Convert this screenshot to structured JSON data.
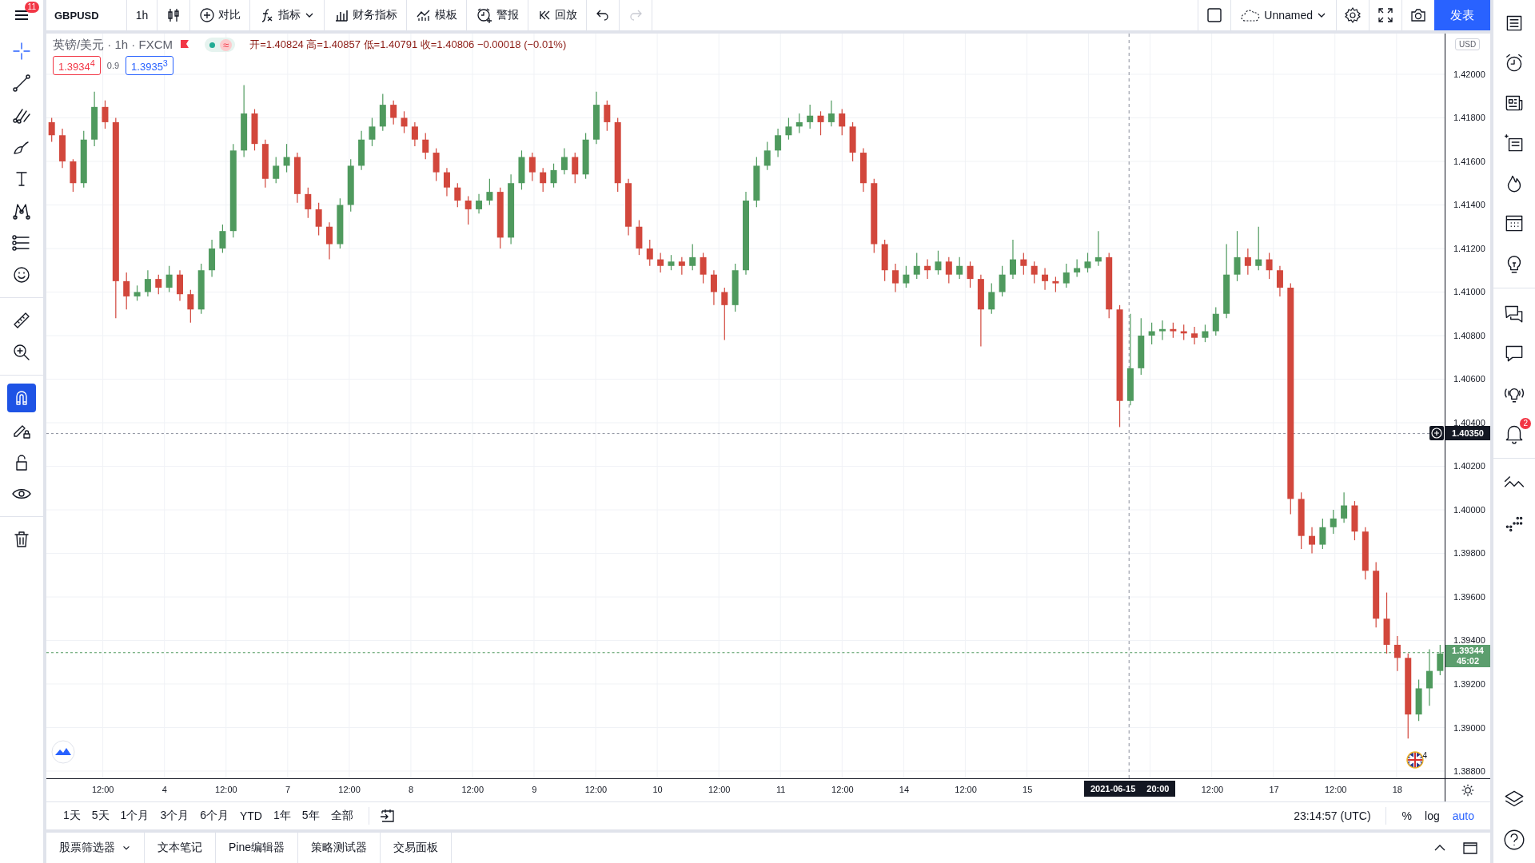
{
  "top_bar": {
    "menu_badge": "11",
    "symbol": "GBPUSD",
    "interval": "1h",
    "compare": "对比",
    "indicators": "指标",
    "financials": "财务指标",
    "templates": "模板",
    "alert": "警报",
    "replay": "回放",
    "redo_disabled": true,
    "layout_name": "Unnamed",
    "publish": "发表"
  },
  "tools": [
    {
      "kind": "crosshair",
      "active": true
    },
    {
      "kind": "trend-line",
      "active": false
    },
    {
      "kind": "pitchfork",
      "active": false
    },
    {
      "kind": "brush",
      "active": false
    },
    {
      "kind": "text",
      "active": false
    },
    {
      "kind": "pattern",
      "active": false
    },
    {
      "kind": "forecast",
      "active": false
    },
    {
      "kind": "emoji",
      "active": false
    },
    {
      "kind": "ruler",
      "active": false
    },
    {
      "kind": "zoom",
      "active": false
    },
    {
      "kind": "magnet",
      "active": true
    },
    {
      "kind": "lock-drawing",
      "active": false
    },
    {
      "kind": "lock",
      "active": false
    },
    {
      "kind": "eye",
      "active": false
    },
    {
      "kind": "trash",
      "active": false
    }
  ],
  "legend": {
    "title": "英镑/美元 · 1h · FXCM",
    "toggle_glyph": "≈",
    "ohlc": "开=1.40824 高=1.40857 低=1.40791 收=1.40806 −0.00018 (−0.01%)",
    "sell": "1.3934$^{4}$",
    "spread": "0.9",
    "buy": "1.3935$^{3}$"
  },
  "chart": {
    "chart_data": {
      "type": "candlestick",
      "categories": [
        null,
        null,
        null,
        null,
        null,
        null,
        null,
        null,
        null,
        null,
        null,
        null,
        null,
        null,
        null,
        null,
        null,
        null,
        null,
        null,
        null,
        null,
        null,
        null,
        null,
        null,
        null,
        null,
        null,
        null,
        null,
        null,
        null,
        null,
        null,
        null,
        null,
        null,
        null,
        null,
        null,
        null,
        null,
        null,
        null,
        null,
        null,
        null,
        null,
        null,
        null,
        null,
        null,
        null,
        null,
        null,
        null,
        null,
        null,
        null,
        null,
        null,
        null,
        null,
        null,
        null,
        null,
        null,
        null,
        null,
        null,
        null,
        null,
        null,
        null,
        null,
        null,
        null,
        null,
        null,
        null,
        null,
        null,
        null,
        null,
        null,
        null,
        null,
        null,
        null,
        null,
        null,
        null,
        null,
        null,
        null,
        null,
        null,
        null,
        null,
        null,
        null,
        null,
        null,
        null,
        null,
        null,
        null,
        null,
        null,
        null,
        null,
        null,
        null,
        null,
        null,
        null,
        null,
        null,
        null,
        null,
        null,
        null,
        null,
        null,
        null,
        null,
        null,
        null,
        null,
        null
      ],
      "ohlc": [
        [
          1.4178,
          1.418,
          1.4169,
          1.4172
        ],
        [
          1.4172,
          1.4175,
          1.4157,
          1.416
        ],
        [
          1.416,
          1.4161,
          1.4146,
          1.415
        ],
        [
          1.415,
          1.4174,
          1.4148,
          1.417
        ],
        [
          1.417,
          1.4192,
          1.4167,
          1.4185
        ],
        [
          1.4185,
          1.4188,
          1.4175,
          1.4178
        ],
        [
          1.4178,
          1.418,
          1.4088,
          1.4105
        ],
        [
          1.4105,
          1.4109,
          1.4092,
          1.4098
        ],
        [
          1.4098,
          1.4103,
          1.4096,
          1.41
        ],
        [
          1.41,
          1.411,
          1.4098,
          1.4106
        ],
        [
          1.4106,
          1.4108,
          1.4099,
          1.4102
        ],
        [
          1.4102,
          1.4112,
          1.41,
          1.4108
        ],
        [
          1.4108,
          1.411,
          1.4096,
          1.4099
        ],
        [
          1.4099,
          1.4101,
          1.4086,
          1.4092
        ],
        [
          1.4092,
          1.4113,
          1.409,
          1.411
        ],
        [
          1.411,
          1.4124,
          1.4107,
          1.412
        ],
        [
          1.412,
          1.4131,
          1.4118,
          1.4128
        ],
        [
          1.4128,
          1.4168,
          1.4125,
          1.4165
        ],
        [
          1.4165,
          1.4195,
          1.4162,
          1.4182
        ],
        [
          1.4182,
          1.4184,
          1.4165,
          1.4168
        ],
        [
          1.4168,
          1.417,
          1.4148,
          1.4152
        ],
        [
          1.4152,
          1.4162,
          1.415,
          1.4158
        ],
        [
          1.4158,
          1.4168,
          1.4155,
          1.4162
        ],
        [
          1.4162,
          1.4164,
          1.4141,
          1.4145
        ],
        [
          1.4145,
          1.4148,
          1.4134,
          1.4138
        ],
        [
          1.4138,
          1.4141,
          1.4126,
          1.413
        ],
        [
          1.413,
          1.4132,
          1.4115,
          1.4122
        ],
        [
          1.4122,
          1.4143,
          1.412,
          1.414
        ],
        [
          1.414,
          1.4161,
          1.4137,
          1.4158
        ],
        [
          1.4158,
          1.4174,
          1.4156,
          1.417
        ],
        [
          1.417,
          1.418,
          1.4167,
          1.4176
        ],
        [
          1.4176,
          1.4191,
          1.4174,
          1.4186
        ],
        [
          1.4186,
          1.4188,
          1.4177,
          1.418
        ],
        [
          1.418,
          1.4183,
          1.4173,
          1.4176
        ],
        [
          1.4176,
          1.4178,
          1.4167,
          1.417
        ],
        [
          1.417,
          1.4173,
          1.4161,
          1.4164
        ],
        [
          1.4164,
          1.4166,
          1.4151,
          1.4155
        ],
        [
          1.4155,
          1.4157,
          1.4144,
          1.4148
        ],
        [
          1.4148,
          1.415,
          1.4139,
          1.4142
        ],
        [
          1.4142,
          1.4144,
          1.4131,
          1.4138
        ],
        [
          1.4138,
          1.4145,
          1.4136,
          1.4142
        ],
        [
          1.4142,
          1.4152,
          1.414,
          1.4146
        ],
        [
          1.4146,
          1.4148,
          1.412,
          1.4125
        ],
        [
          1.4125,
          1.4154,
          1.4122,
          1.415
        ],
        [
          1.415,
          1.4165,
          1.4147,
          1.4162
        ],
        [
          1.4162,
          1.4164,
          1.4151,
          1.4155
        ],
        [
          1.4155,
          1.4157,
          1.4146,
          1.415
        ],
        [
          1.415,
          1.4159,
          1.4148,
          1.4156
        ],
        [
          1.4156,
          1.4166,
          1.4154,
          1.4162
        ],
        [
          1.4162,
          1.4164,
          1.415,
          1.4154
        ],
        [
          1.4154,
          1.4173,
          1.4152,
          1.417
        ],
        [
          1.417,
          1.4192,
          1.4168,
          1.4186
        ],
        [
          1.4186,
          1.4188,
          1.4174,
          1.4178
        ],
        [
          1.4178,
          1.418,
          1.4146,
          1.415
        ],
        [
          1.415,
          1.4152,
          1.4126,
          1.413
        ],
        [
          1.413,
          1.4133,
          1.4117,
          1.412
        ],
        [
          1.412,
          1.4124,
          1.4112,
          1.4115
        ],
        [
          1.4115,
          1.4118,
          1.4109,
          1.4112
        ],
        [
          1.4112,
          1.4117,
          1.411,
          1.4114
        ],
        [
          1.4114,
          1.4116,
          1.4108,
          1.4112
        ],
        [
          1.4112,
          1.4122,
          1.411,
          1.4116
        ],
        [
          1.4116,
          1.4118,
          1.4104,
          1.4108
        ],
        [
          1.4108,
          1.411,
          1.4094,
          1.41
        ],
        [
          1.41,
          1.4102,
          1.4078,
          1.4094
        ],
        [
          1.4094,
          1.4113,
          1.4091,
          1.411
        ],
        [
          1.411,
          1.4146,
          1.4108,
          1.4142
        ],
        [
          1.4142,
          1.4162,
          1.4139,
          1.4158
        ],
        [
          1.4158,
          1.4169,
          1.4156,
          1.4165
        ],
        [
          1.4165,
          1.4175,
          1.4162,
          1.4172
        ],
        [
          1.4172,
          1.418,
          1.417,
          1.4176
        ],
        [
          1.4176,
          1.4182,
          1.4173,
          1.4178
        ],
        [
          1.4178,
          1.4186,
          1.4175,
          1.4181
        ],
        [
          1.4181,
          1.4183,
          1.4172,
          1.4178
        ],
        [
          1.4178,
          1.4188,
          1.4176,
          1.4182
        ],
        [
          1.4182,
          1.4184,
          1.4172,
          1.4176
        ],
        [
          1.4176,
          1.4178,
          1.416,
          1.4164
        ],
        [
          1.4164,
          1.4166,
          1.4146,
          1.415
        ],
        [
          1.415,
          1.4152,
          1.4118,
          1.4122
        ],
        [
          1.4122,
          1.4124,
          1.4105,
          1.411
        ],
        [
          1.411,
          1.4113,
          1.41,
          1.4104
        ],
        [
          1.4104,
          1.4112,
          1.4102,
          1.4108
        ],
        [
          1.4108,
          1.4118,
          1.4106,
          1.4112
        ],
        [
          1.4112,
          1.4115,
          1.4106,
          1.411
        ],
        [
          1.411,
          1.4119,
          1.4108,
          1.4114
        ],
        [
          1.4114,
          1.4116,
          1.4104,
          1.4108
        ],
        [
          1.4108,
          1.4116,
          1.4106,
          1.4112
        ],
        [
          1.4112,
          1.4114,
          1.4102,
          1.4106
        ],
        [
          1.4106,
          1.4108,
          1.4075,
          1.4092
        ],
        [
          1.4092,
          1.4104,
          1.409,
          1.41
        ],
        [
          1.41,
          1.4112,
          1.4098,
          1.4108
        ],
        [
          1.4108,
          1.4124,
          1.4106,
          1.4115
        ],
        [
          1.4115,
          1.4118,
          1.4108,
          1.4112
        ],
        [
          1.4112,
          1.4114,
          1.4104,
          1.4108
        ],
        [
          1.4108,
          1.4111,
          1.4101,
          1.4105
        ],
        [
          1.4105,
          1.4107,
          1.41,
          1.4104
        ],
        [
          1.4104,
          1.4113,
          1.4102,
          1.4109
        ],
        [
          1.4109,
          1.4115,
          1.4107,
          1.4111
        ],
        [
          1.4111,
          1.4118,
          1.4109,
          1.4114
        ],
        [
          1.4114,
          1.4128,
          1.4112,
          1.4116
        ],
        [
          1.4116,
          1.4118,
          1.4088,
          1.4092
        ],
        [
          1.4092,
          1.4094,
          1.4038,
          1.405
        ],
        [
          1.405,
          1.409,
          1.4048,
          1.4065
        ],
        [
          1.4065,
          1.4088,
          1.4062,
          1.408
        ],
        [
          1.408,
          1.4086,
          1.4076,
          1.4082
        ],
        [
          1.4082,
          1.4087,
          1.4078,
          1.4083
        ],
        [
          1.4083,
          1.4086,
          1.4079,
          1.4082
        ],
        [
          1.4082,
          1.4085,
          1.4078,
          1.4081
        ],
        [
          1.4081,
          1.4084,
          1.4076,
          1.4079
        ],
        [
          1.4079,
          1.4085,
          1.4077,
          1.4082
        ],
        [
          1.4082,
          1.4093,
          1.408,
          1.409
        ],
        [
          1.409,
          1.4122,
          1.4088,
          1.4108
        ],
        [
          1.4108,
          1.4128,
          1.4105,
          1.4116
        ],
        [
          1.4116,
          1.412,
          1.4108,
          1.4112
        ],
        [
          1.4112,
          1.413,
          1.411,
          1.4115
        ],
        [
          1.4115,
          1.4118,
          1.4106,
          1.411
        ],
        [
          1.411,
          1.4112,
          1.4098,
          1.4102
        ],
        [
          1.4102,
          1.4104,
          1.3998,
          1.4005
        ],
        [
          1.4005,
          1.4008,
          1.3982,
          1.3988
        ],
        [
          1.3988,
          1.3992,
          1.398,
          1.3984
        ],
        [
          1.3984,
          1.3996,
          1.3982,
          1.3992
        ],
        [
          1.3992,
          1.4,
          1.3989,
          1.3996
        ],
        [
          1.3996,
          1.4008,
          1.3994,
          1.4002
        ],
        [
          1.4002,
          1.4004,
          1.3986,
          1.399
        ],
        [
          1.399,
          1.3992,
          1.3968,
          1.3972
        ],
        [
          1.3972,
          1.3976,
          1.3946,
          1.395
        ],
        [
          1.395,
          1.3962,
          1.3934,
          1.3938
        ],
        [
          1.3938,
          1.3942,
          1.3926,
          1.3932
        ],
        [
          1.3932,
          1.3934,
          1.3895,
          1.3906
        ],
        [
          1.3906,
          1.3922,
          1.3903,
          1.3918
        ],
        [
          1.3918,
          1.3936,
          1.391,
          1.3926
        ],
        [
          1.3926,
          1.3938,
          1.3924,
          1.3934
        ]
      ],
      "ylim": [
        1.38767,
        1.42187
      ],
      "grid": true,
      "ref_lines": [
        {
          "axis": "y",
          "value": 1.4035,
          "color": "#8a8f9c"
        },
        {
          "axis": "y",
          "value": 1.39344,
          "color": "#4f9a5e"
        }
      ],
      "yticks": [
        {
          "value": 1.42,
          "label": "1.42000"
        },
        {
          "value": 1.418,
          "label": "1.41800"
        },
        {
          "value": 1.416,
          "label": "1.41600"
        },
        {
          "value": 1.414,
          "label": "1.41400"
        },
        {
          "value": 1.412,
          "label": "1.41200"
        },
        {
          "value": 1.41,
          "label": "1.41000"
        },
        {
          "value": 1.408,
          "label": "1.40800"
        },
        {
          "value": 1.406,
          "label": "1.40600"
        },
        {
          "value": 1.404,
          "label": "1.40400"
        },
        {
          "value": 1.402,
          "label": "1.40200"
        },
        {
          "value": 1.4,
          "label": "1.40000"
        },
        {
          "value": 1.398,
          "label": "1.39800"
        },
        {
          "value": 1.396,
          "label": "1.39600"
        },
        {
          "value": 1.394,
          "label": "1.39400"
        },
        {
          "value": 1.392,
          "label": "1.39200"
        },
        {
          "value": 1.39,
          "label": "1.39000"
        },
        {
          "value": 1.388,
          "label": "1.38800"
        }
      ]
    }
  },
  "price_axis": {
    "currency": "USD",
    "crosshair_price": "1.40350",
    "last_price": "1.39344",
    "countdown": "45:02"
  },
  "time_axis": {
    "labels": [
      "12:00",
      "4",
      "12:00",
      "7",
      "12:00",
      "8",
      "12:00",
      "9",
      "12:00",
      "10",
      "12:00",
      "11",
      "12:00",
      "14",
      "12:00",
      "15",
      "12:00",
      "17",
      "12:00",
      "18"
    ],
    "crosshair_date": "2021-06-15",
    "crosshair_time": "20:00"
  },
  "chart_badges": {
    "flag_count": "4"
  },
  "range_bar": {
    "ranges": [
      {
        "label": "1天",
        "selected": false
      },
      {
        "label": "5天",
        "selected": false
      },
      {
        "label": "1个月",
        "selected": false
      },
      {
        "label": "3个月",
        "selected": false
      },
      {
        "label": "6个月",
        "selected": false
      },
      {
        "label": "YTD",
        "selected": false
      },
      {
        "label": "1年",
        "selected": false
      },
      {
        "label": "5年",
        "selected": false
      },
      {
        "label": "全部",
        "selected": false
      }
    ],
    "clock": "23:14:57 (UTC)",
    "scale_options": [
      {
        "label": "%",
        "selected": false
      },
      {
        "label": "log",
        "selected": false
      },
      {
        "label": "auto",
        "selected": true
      }
    ]
  },
  "bottom_tabs": [
    {
      "label": "股票筛选器",
      "kind": "dropdown"
    },
    {
      "label": "文本笔记",
      "kind": "tab"
    },
    {
      "label": "Pine编辑器",
      "kind": "tab"
    },
    {
      "label": "策略测试器",
      "kind": "tab"
    },
    {
      "label": "交易面板",
      "kind": "tab"
    }
  ],
  "right_sidebar": {
    "alert_badge": "2"
  }
}
